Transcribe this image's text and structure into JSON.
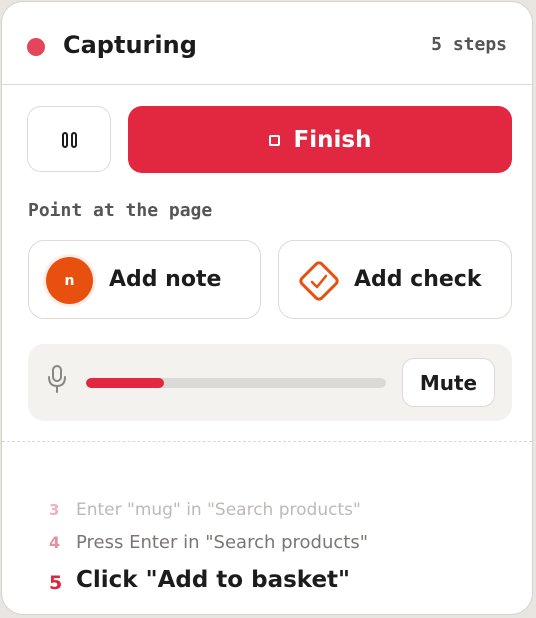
{
  "header": {
    "status": "Capturing",
    "steps_count": "5 steps"
  },
  "controls": {
    "pause_icon": "pause-icon",
    "finish_label": "Finish",
    "finish_icon": "stop-icon"
  },
  "section_label": "Point at the page",
  "actions": {
    "note": {
      "label": "Add note",
      "icon_glyph": "n",
      "icon": "note-icon"
    },
    "check": {
      "label": "Add check",
      "icon": "check-diamond-icon"
    }
  },
  "mic": {
    "icon": "microphone-icon",
    "level_fraction": 0.26,
    "mute_label": "Mute"
  },
  "steps": [
    {
      "number": "3",
      "text": "Enter \"mug\" in \"Search products\""
    },
    {
      "number": "4",
      "text": "Press Enter in \"Search products\""
    },
    {
      "number": "5",
      "text": "Click \"Add to basket\""
    }
  ],
  "colors": {
    "accent": "#e22840",
    "recording_dot": "#e3455a",
    "note_orange": "#e8500f",
    "panel_background": "#ffffff"
  }
}
